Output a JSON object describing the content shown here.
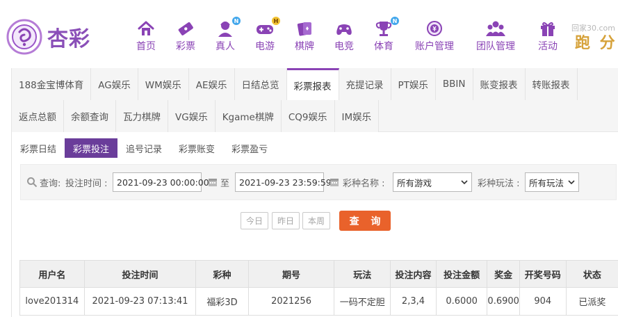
{
  "brand": {
    "name": "杏彩"
  },
  "nav": [
    {
      "label": "首页",
      "icon": "home-icon"
    },
    {
      "label": "彩票",
      "icon": "lottery-ticket-icon"
    },
    {
      "label": "真人",
      "icon": "live-dealer-icon",
      "badge": "N"
    },
    {
      "label": "电游",
      "icon": "gamepad-icon",
      "badge": "H"
    },
    {
      "label": "棋牌",
      "icon": "cards-icon"
    },
    {
      "label": "电竞",
      "icon": "esports-controller-icon"
    },
    {
      "label": "体育",
      "icon": "trophy-icon",
      "badge": "N"
    },
    {
      "label": "账户管理",
      "icon": "account-icon"
    },
    {
      "label": "团队管理",
      "icon": "team-icon"
    },
    {
      "label": "活动",
      "icon": "gift-icon"
    }
  ],
  "watermark": {
    "url": "回家30.com",
    "badge": "跑 分"
  },
  "tabs_row1": [
    "188金宝博体育",
    "AG娱乐",
    "WM娱乐",
    "AE娱乐",
    "日结总览",
    "彩票报表",
    "充提记录",
    "PT娱乐",
    "BBIN",
    "账变报表",
    "转账报表"
  ],
  "tabs_row2": [
    "返点总额",
    "余额查询",
    "瓦力棋牌",
    "VG娱乐",
    "Kgame棋牌",
    "CQ9娱乐",
    "IM娱乐"
  ],
  "active_tab": "彩票报表",
  "subtabs": [
    "彩票日结",
    "彩票投注",
    "追号记录",
    "彩票账变",
    "彩票盈亏"
  ],
  "active_subtab": "彩票投注",
  "filter": {
    "query_label": "查询:",
    "time_label": "投注时间 :",
    "start_time": "2021-09-23 00:00:00",
    "to_label": "至",
    "end_time": "2021-09-23 23:59:59",
    "game_label": "彩种名称 :",
    "game_value": "所有游戏",
    "play_label": "彩种玩法 :",
    "play_value": "所有玩法"
  },
  "quick_buttons": {
    "today": "今日",
    "yesterday": "昨日",
    "this_week": "本周",
    "query": "查 询"
  },
  "table": {
    "headers": [
      "用户名",
      "投注时间",
      "彩种",
      "期号",
      "玩法",
      "投注内容",
      "投注金额",
      "奖金",
      "开奖号码",
      "状态"
    ],
    "rows": [
      [
        "love201314",
        "2021-09-23 07:13:41",
        "福彩3D",
        "2021256",
        "一码不定胆",
        "2,3,4",
        "0.6000",
        "0.6900",
        "904",
        "已派奖"
      ]
    ]
  },
  "colors": {
    "brand_purple": "#8a43b5",
    "active_subtab": "#6a3d9a",
    "query_button": "#e9622b",
    "status_dispatched": "#e9622b"
  }
}
